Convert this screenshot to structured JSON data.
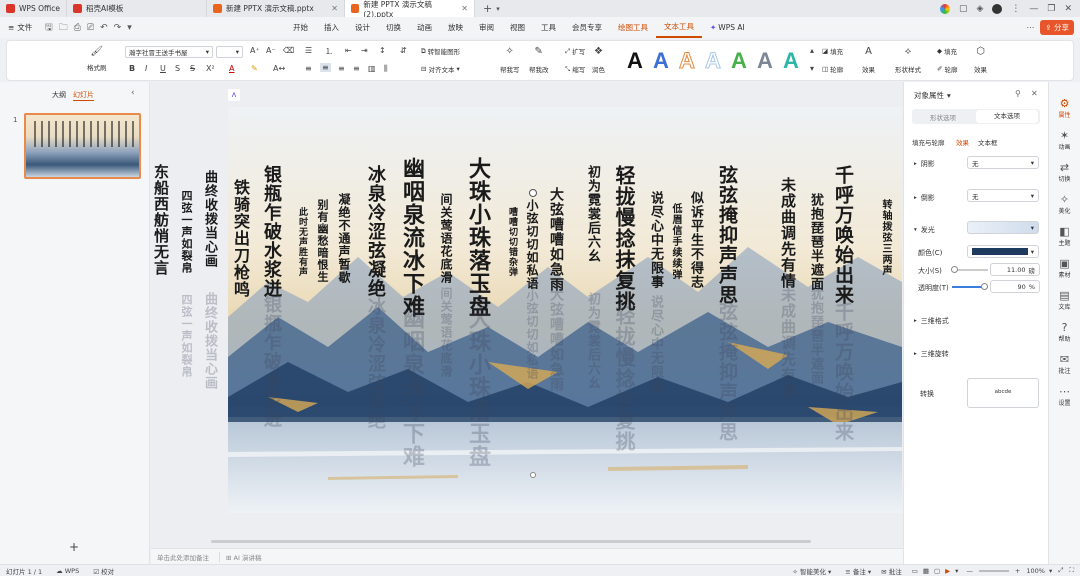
{
  "tabs": [
    {
      "label": "WPS Office",
      "color": "#d9352b"
    },
    {
      "label": "稻壳AI模板",
      "color": "#d9352b"
    },
    {
      "label": "新建 PPTX 演示文稿.pptx",
      "color": "#e8641f"
    },
    {
      "label": "新建 PPTX 演示文稿 (2).pptx",
      "color": "#e8641f"
    }
  ],
  "titlebar": {
    "add_tab": "+"
  },
  "menu": {
    "file": "文件",
    "items": [
      "开始",
      "插入",
      "设计",
      "切换",
      "动画",
      "放映",
      "审阅",
      "视图",
      "工具",
      "会员专享",
      "绘图工具",
      "文本工具",
      "WPS AI"
    ],
    "share": "分享"
  },
  "ribbon": {
    "format_painter": "格式刷",
    "font_name": "瀚字社冒王送手书屋",
    "font_size": "",
    "smart_shape": "转智能图形",
    "align_text": "对齐文本",
    "help_write": "帮我写",
    "help_typeset": "帮我改",
    "expand": "扩写",
    "shorten": "缩写",
    "polish": "润色",
    "fill": "填充",
    "outline": "轮廓",
    "effect": "效果",
    "shape_style": "形状样式",
    "fill2": "填充",
    "outline2": "轮廓",
    "effect2": "效果",
    "styles": [
      {
        "letter": "A",
        "color": "#111111"
      },
      {
        "letter": "A",
        "color": "#3b6fd8"
      },
      {
        "letter": "A",
        "color": "#e8883a"
      },
      {
        "letter": "A",
        "color": "#a8c8e8"
      },
      {
        "letter": "A",
        "color": "#47b04b"
      },
      {
        "letter": "A",
        "color": "#7b8794"
      },
      {
        "letter": "A",
        "color": "#2cb5a8"
      }
    ]
  },
  "leftpanel": {
    "tab_outline": "大纲",
    "tab_slides": "幻灯片",
    "slide_number": "1",
    "add": "+"
  },
  "notes": {
    "placeholder": "单击此处添加备注",
    "ai_notes": "AI 演讲稿"
  },
  "slide": {
    "columns": [
      "千呼万唤始出来",
      "犹抱琵琶半遮面",
      "转轴拨弦三两声",
      "未成曲调先有情",
      "弦弦掩抑声声思",
      "似诉平生不得志",
      "低眉信手续续弹",
      "说尽心中无限事",
      "轻拢慢捻抹复挑",
      "初为霓裳后六幺",
      "大弦嘈嘈如急雨",
      "小弦切切如私语",
      "嘈嘈切切错杂弹",
      "大珠小珠落玉盘",
      "间关莺语花底滑",
      "幽咽泉流冰下难",
      "冰泉冷涩弦凝绝",
      "凝绝不通声暂歇",
      "别有幽愁暗恨生",
      "此时无声胜有声",
      "银瓶乍破水浆迸",
      "铁骑突出刀枪鸣",
      "曲终收拨当心画",
      "四弦一声如裂帛",
      "东船西舫悄无言"
    ]
  },
  "rightpanel": {
    "title": "对象属性",
    "tab_shape": "形状选项",
    "tab_text": "文本选项",
    "sub_fill": "填充与轮廓",
    "sub_effect": "效果",
    "sub_textbox": "文本框",
    "shadow": "阴影",
    "shadow_value": "无",
    "reflection": "倒影",
    "reflection_value": "无",
    "glow": "发光",
    "color_label": "颜色(C)",
    "glow_color": "#1f3a5f",
    "size_label": "大小(S)",
    "size_value": "11.00",
    "size_unit": "磅",
    "size_fraction": 0.05,
    "transparency_label": "透明度(T)",
    "transparency_value": "90",
    "transparency_unit": "%",
    "transparency_fraction": 0.9,
    "format3d": "三维格式",
    "rotation3d": "三维旋转",
    "transform": "转换",
    "transform_sample": "abcde"
  },
  "sidebar": {
    "items": [
      "属性",
      "动画",
      "切换",
      "美化",
      "主题",
      "素材",
      "文库",
      "帮助",
      "批注",
      "设置"
    ]
  },
  "status": {
    "slide_count": "幻灯片 1 / 1",
    "wps": "WPS",
    "proof": "校对",
    "smart_beautify": "智能美化",
    "notes": "备注",
    "comments": "批注",
    "zoom": "100%"
  }
}
